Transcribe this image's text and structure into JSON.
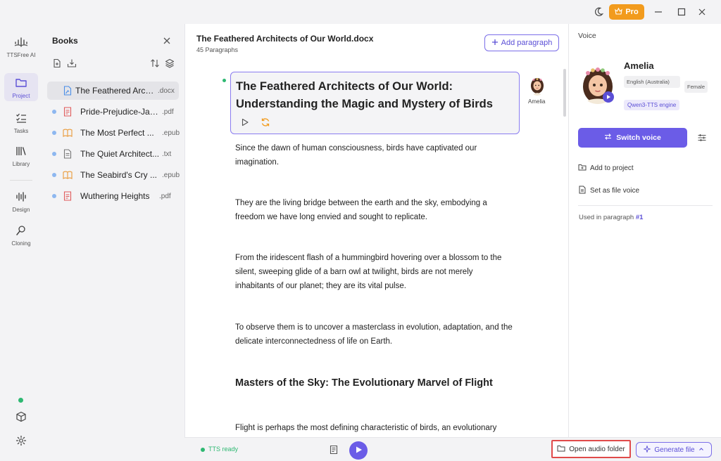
{
  "titlebar": {
    "pro_label": "Pro",
    "accent": "#f29b1d"
  },
  "rail": {
    "brand_label": "TTSFree AI",
    "items": [
      {
        "label": "Project",
        "icon": "folder-icon",
        "active": true
      },
      {
        "label": "Tasks",
        "icon": "tasks-icon"
      },
      {
        "label": "Library",
        "icon": "library-icon"
      },
      {
        "label": "Design",
        "icon": "waveform-icon"
      },
      {
        "label": "Cloning",
        "icon": "cloning-icon"
      }
    ]
  },
  "books": {
    "title": "Books",
    "items": [
      {
        "name": "The Feathered Arch...",
        "ext": ".docx",
        "icon": "docx-icon",
        "active": true
      },
      {
        "name": "Pride-Prejudice-Jan...",
        "ext": ".pdf",
        "icon": "pdf-icon"
      },
      {
        "name": "The Most Perfect ...",
        "ext": ".epub",
        "icon": "epub-icon"
      },
      {
        "name": "The Quiet Architect...",
        "ext": ".txt",
        "icon": "txt-icon"
      },
      {
        "name": "The Seabird's Cry ...",
        "ext": ".epub",
        "icon": "epub-icon"
      },
      {
        "name": "Wuthering Heights",
        "ext": ".pdf",
        "icon": "pdf-icon"
      }
    ]
  },
  "document": {
    "title": "The Feathered Architects of Our World.docx",
    "subtitle": "45 Paragraphs",
    "add_paragraph": "Add paragraph",
    "heading": "The Feathered Architects of Our World: Understanding the Magic and Mystery of Birds",
    "heading_voice": "Amelia",
    "paragraphs": [
      "Since the dawn of human consciousness, birds have captivated our imagination.",
      "They are the living bridge between the earth and the sky, embodying a freedom we have long envied and sought to replicate.",
      "From the iridescent flash of a hummingbird hovering over a blossom to the silent, sweeping glide of a barn owl at twilight, birds are not merely inhabitants of our planet; they are its vital pulse.",
      "To observe them is to uncover a masterclass in evolution, adaptation, and the delicate interconnectedness of life on Earth."
    ],
    "section_heading": "Masters of the Sky: The Evolutionary Marvel of Flight",
    "last_paragraph": "Flight is perhaps the most defining characteristic of birds, an evolutionary"
  },
  "bottom": {
    "status": "TTS ready",
    "open_audio_folder": "Open audio folder",
    "generate_file": "Generate file"
  },
  "voice": {
    "panel_title": "Voice",
    "name": "Amelia",
    "language": "English (Australia)",
    "gender": "Female",
    "engine": "Qwen3-TTS engine",
    "switch_voice": "Switch voice",
    "add_to_project": "Add to project",
    "set_as_file_voice": "Set as file voice",
    "used_in_prefix": "Used in paragraph",
    "used_in_ref": "#1"
  },
  "colors": {
    "primary": "#6b5ce7",
    "ready": "#2eb872",
    "highlight_border": "#e04a4a"
  }
}
